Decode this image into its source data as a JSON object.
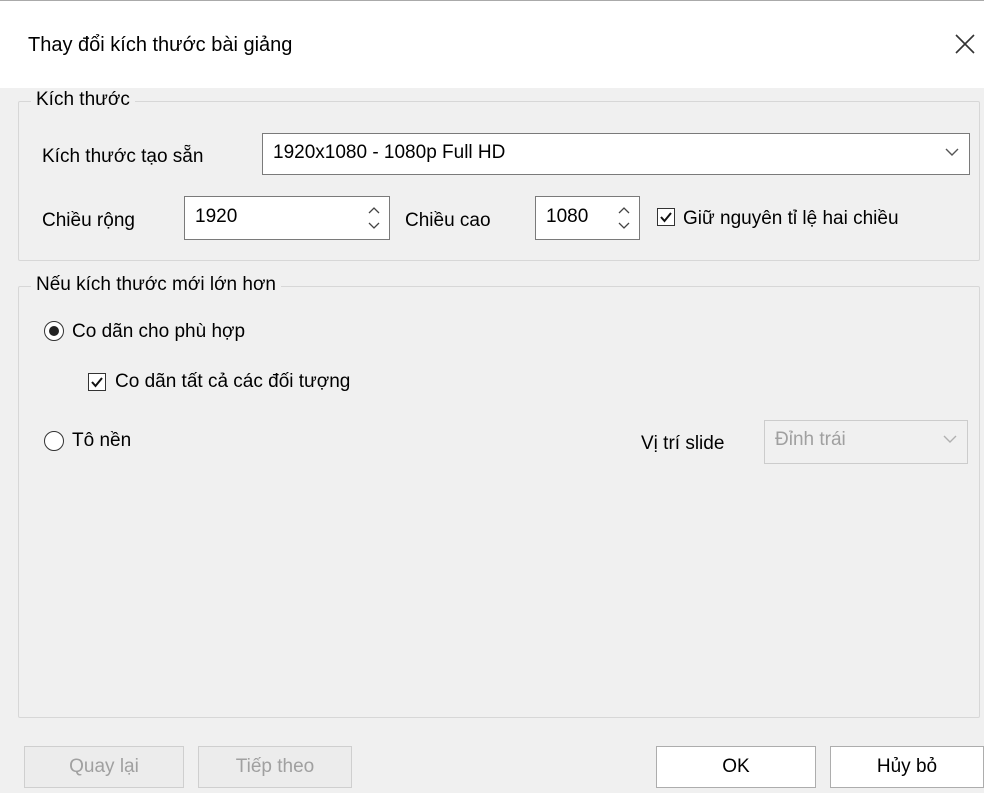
{
  "dialog": {
    "title": "Thay đổi kích thước bài giảng",
    "close_icon": "close-icon"
  },
  "size_group": {
    "legend": "Kích thước",
    "preset_label": "Kích thước tạo sẵn",
    "preset_value": "1920x1080 - 1080p Full HD",
    "width_label": "Chiều rộng",
    "width_value": "1920",
    "height_label": "Chiều cao",
    "height_value": "1080",
    "keep_ratio_label": "Giữ nguyên tỉ lệ hai chiều",
    "keep_ratio_checked": true
  },
  "larger_group": {
    "legend": "Nếu kích thước mới lớn hơn",
    "option_fit_label": "Co dãn cho phù hợp",
    "option_fit_selected": true,
    "scale_all_label": "Co dãn tất cả các đối tượng",
    "scale_all_checked": true,
    "option_fill_label": "Tô nền",
    "option_fill_selected": false,
    "slide_position_label": "Vị trí slide",
    "slide_position_value": "Đỉnh trái"
  },
  "buttons": {
    "back": "Quay lại",
    "next": "Tiếp theo",
    "ok": "OK",
    "cancel": "Hủy bỏ"
  }
}
